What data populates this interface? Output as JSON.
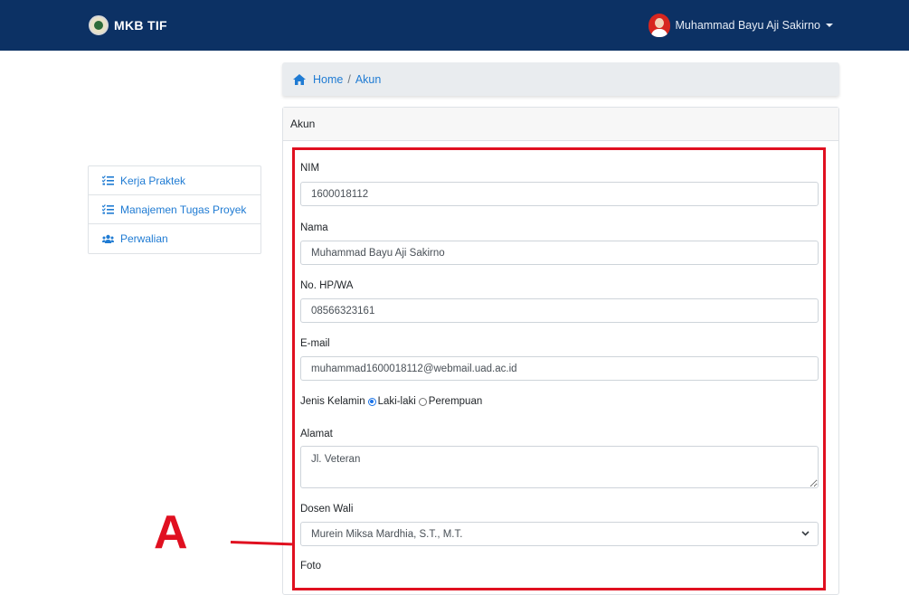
{
  "navbar": {
    "brand": "MKB TIF",
    "user_name": "Muhammad Bayu Aji Sakirno"
  },
  "breadcrumb": {
    "home": "Home",
    "separator": "/",
    "current": "Akun"
  },
  "sidebar": {
    "items": [
      {
        "label": "Kerja Praktek",
        "icon": "list-check-icon"
      },
      {
        "label": "Manajemen Tugas Proyek",
        "icon": "list-check-icon"
      },
      {
        "label": "Perwalian",
        "icon": "users-icon"
      }
    ]
  },
  "card": {
    "title": "Akun"
  },
  "form": {
    "nim_label": "NIM",
    "nim_value": "1600018112",
    "nama_label": "Nama",
    "nama_value": "Muhammad Bayu Aji Sakirno",
    "phone_label": "No. HP/WA",
    "phone_value": "08566323161",
    "email_label": "E-mail",
    "email_value": "muhammad1600018112@webmail.uad.ac.id",
    "gender_label": "Jenis Kelamin",
    "gender_options": [
      "Laki-laki",
      "Perempuan"
    ],
    "gender_selected": "Laki-laki",
    "alamat_label": "Alamat",
    "alamat_value": "Jl. Veteran",
    "dosen_label": "Dosen Wali",
    "dosen_value": "Murein Miksa Mardhia, S.T., M.T.",
    "foto_label": "Foto"
  },
  "annotation": {
    "label": "A",
    "color": "#e01020"
  },
  "colors": {
    "navbar": "#0c3164",
    "link": "#1f7bd3",
    "highlight": "#e01020"
  }
}
